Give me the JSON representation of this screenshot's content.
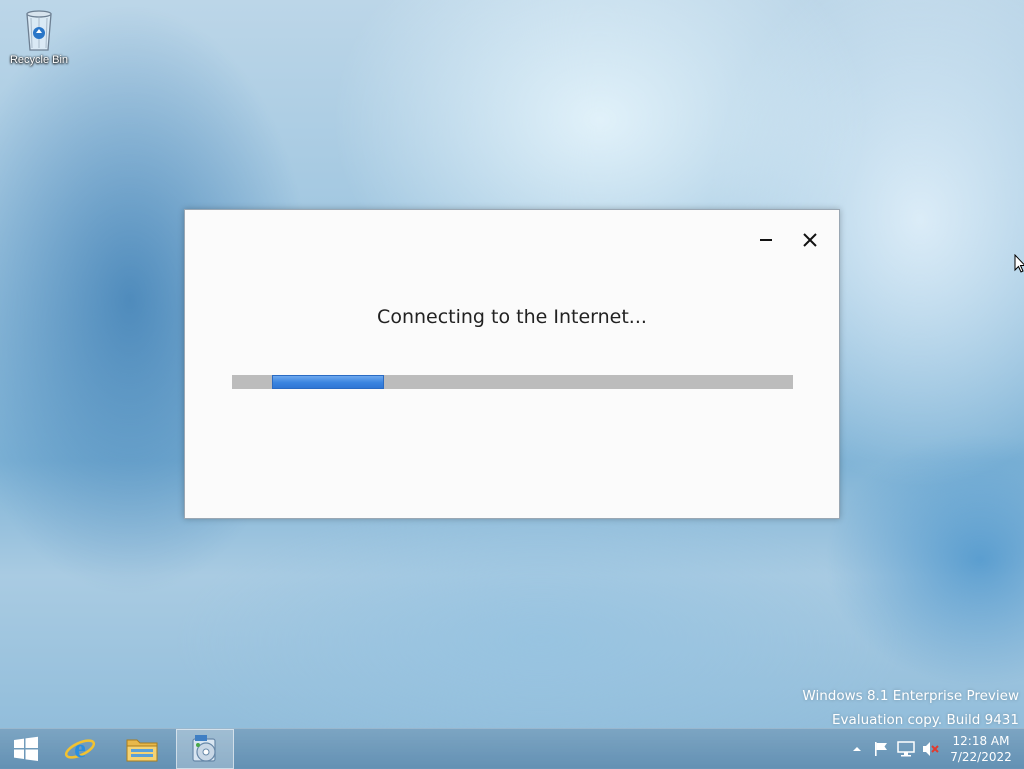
{
  "desktop": {
    "icons": [
      {
        "label": "Recycle Bin",
        "icon": "recycle-bin-icon"
      }
    ],
    "watermark": {
      "line1": "Windows 8.1 Enterprise Preview",
      "line2": "Evaluation copy. Build 9431"
    }
  },
  "dialog": {
    "status_text": "Connecting to the Internet...",
    "progress": {
      "indeterminate": true,
      "fill_fraction": 0.2,
      "accent": "#3a84e0",
      "track": "#bcbcbc"
    },
    "buttons": {
      "minimize": "minimize-icon",
      "close": "close-icon"
    }
  },
  "taskbar": {
    "buttons": [
      "start-icon",
      "internet-explorer-icon",
      "file-explorer-icon",
      "setup-icon"
    ],
    "tray": [
      "show-hidden-icons-icon",
      "action-center-flag-icon",
      "network-icon",
      "volume-muted-icon"
    ],
    "clock": {
      "time": "12:18 AM",
      "date": "7/22/2022"
    }
  }
}
